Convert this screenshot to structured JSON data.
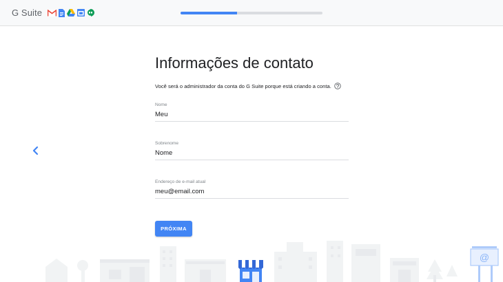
{
  "header": {
    "brand": "G Suite",
    "apps": [
      "gmail-icon",
      "docs-icon",
      "drive-icon",
      "calendar-icon",
      "hangouts-icon"
    ],
    "progress": 0.4
  },
  "main": {
    "title": "Informações de contato",
    "subtitle": "Você será o administrador da conta do G Suite porque está criando a conta.",
    "fields": {
      "first_name": {
        "label": "Nome",
        "value": "Meu"
      },
      "last_name": {
        "label": "Sobrenome",
        "value": "Nome"
      },
      "email": {
        "label": "Endereço de e-mail atual",
        "value": "meu@email.com"
      }
    },
    "next_label": "PRÓXIMA"
  },
  "colors": {
    "accent": "#4285f4",
    "track": "#dadce0",
    "topbar": "#f8f9fa"
  }
}
